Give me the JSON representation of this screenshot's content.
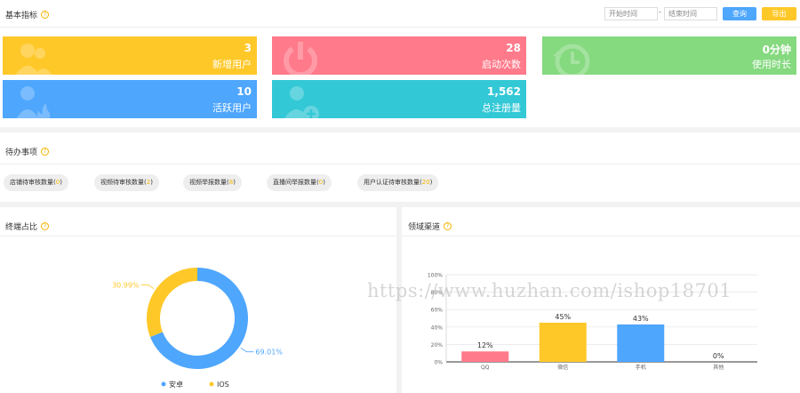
{
  "header": {
    "title": "基本指标",
    "start_placeholder": "开始时间",
    "separator": "-",
    "end_placeholder": "结束时间",
    "query_label": "查询",
    "export_label": "导出"
  },
  "cards": [
    {
      "value": "3",
      "label": "新增用户",
      "color": "#ffc829",
      "icon": "users-icon"
    },
    {
      "value": "28",
      "label": "启动次数",
      "color": "#ff7a8a",
      "icon": "power-icon"
    },
    {
      "value": "0分钟",
      "label": "使用时长",
      "color": "#85d97f",
      "icon": "clock-icon"
    },
    {
      "value": "10",
      "label": "活跃用户",
      "color": "#4ea6fd",
      "icon": "user-fire-icon"
    },
    {
      "value": "1,562",
      "label": "总注册量",
      "color": "#33c8d6",
      "icon": "user-add-icon"
    }
  ],
  "todo": {
    "title": "待办事项",
    "items": [
      {
        "label": "店铺待审核数量",
        "count": "0"
      },
      {
        "label": "视频待审核数量",
        "count": "2"
      },
      {
        "label": "视频举报数量",
        "count": "8"
      },
      {
        "label": "直播间举报数量",
        "count": "0"
      },
      {
        "label": "用户认证待审核数量",
        "count": "20"
      }
    ]
  },
  "terminal": {
    "title": "终端占比"
  },
  "channel": {
    "title": "领域渠道"
  },
  "watermark": "https://www.huzhan.com/ishop18701",
  "chart_data": [
    {
      "type": "pie",
      "title": "终端占比",
      "slices": [
        {
          "name": "安卓",
          "value": 69.01,
          "label": "69.01%",
          "color": "#4ea6fd"
        },
        {
          "name": "IOS",
          "value": 30.99,
          "label": "30.99%",
          "color": "#ffc829"
        }
      ],
      "legend": "bottom"
    },
    {
      "type": "bar",
      "title": "领域渠道",
      "categories": [
        "QQ",
        "微信",
        "手机",
        "其他"
      ],
      "values": [
        12,
        45,
        43,
        0
      ],
      "value_labels": [
        "12%",
        "45%",
        "43%",
        "0%"
      ],
      "colors": [
        "#ff7a8a",
        "#ffc829",
        "#4ea6fd",
        "#33c8d6"
      ],
      "yticks": [
        "0%",
        "20%",
        "40%",
        "60%",
        "80%",
        "100%"
      ],
      "ylim": [
        0,
        100
      ],
      "grid": true
    }
  ]
}
